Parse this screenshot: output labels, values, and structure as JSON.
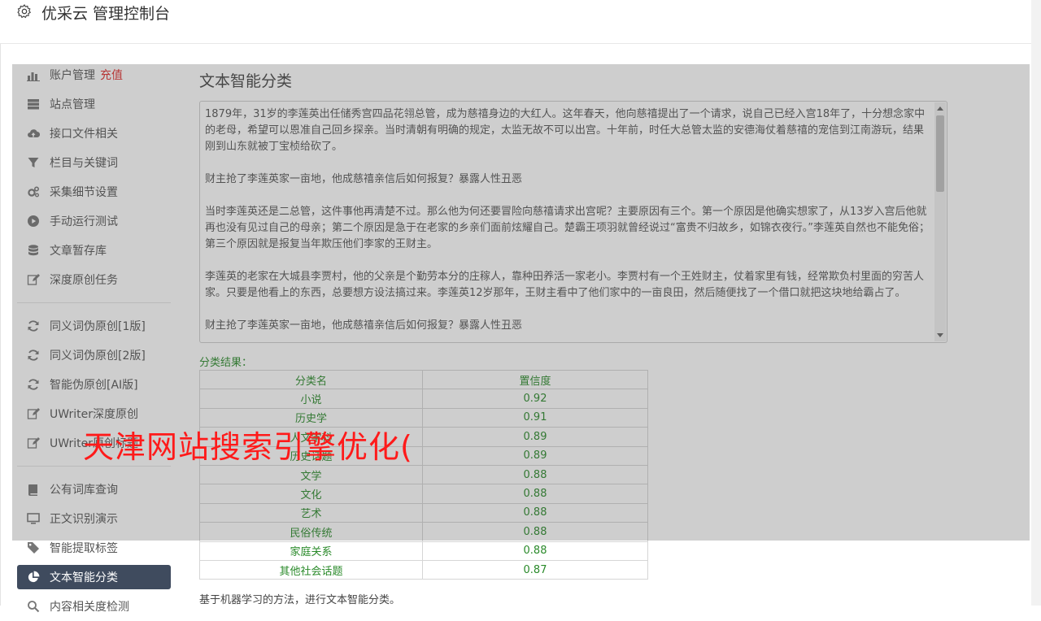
{
  "header": {
    "title": "优采云 管理控制台"
  },
  "sidebar": {
    "groups": [
      [
        {
          "label": "账户管理",
          "badge": "充值",
          "icon": "bar-chart-icon"
        },
        {
          "label": "站点管理",
          "icon": "server-icon"
        },
        {
          "label": "接口文件相关",
          "icon": "cloud-upload-icon"
        },
        {
          "label": "栏目与关键词",
          "icon": "filter-icon"
        },
        {
          "label": "采集细节设置",
          "icon": "gears-icon"
        },
        {
          "label": "手动运行测试",
          "icon": "play-circle-icon"
        },
        {
          "label": "文章暂存库",
          "icon": "database-icon"
        },
        {
          "label": "深度原创任务",
          "icon": "edit-icon"
        }
      ],
      [
        {
          "label": "同义词伪原创[1版]",
          "icon": "refresh-icon"
        },
        {
          "label": "同义词伪原创[2版]",
          "icon": "refresh-icon"
        },
        {
          "label": "智能伪原创[AI版]",
          "icon": "refresh-icon"
        },
        {
          "label": "UWriter深度原创",
          "icon": "edit-icon"
        },
        {
          "label": "UWriter原创标题",
          "icon": "edit-icon"
        }
      ],
      [
        {
          "label": "公有词库查询",
          "icon": "book-icon"
        },
        {
          "label": "正文识别演示",
          "icon": "monitor-icon"
        },
        {
          "label": "智能提取标签",
          "icon": "tag-icon"
        },
        {
          "label": "文本智能分类",
          "icon": "pie-chart-icon",
          "active": true
        },
        {
          "label": "内容相关度检测",
          "icon": "search-icon"
        }
      ]
    ]
  },
  "main": {
    "title": "文本智能分类",
    "text_paragraphs": [
      "1879年，31岁的李莲英出任储秀宫四品花翎总管，成为慈禧身边的大红人。这年春天，他向慈禧提出了一个请求，说自己已经入宫18年了，十分想念家中的老母，希望可以恩准自己回乡探亲。当时清朝有明确的规定，太监无故不可以出宫。十年前，时任大总管太监的安德海仗着慈禧的宠信到江南游玩，结果刚到山东就被丁宝桢给砍了。",
      "财主抢了李莲英家一亩地，他成慈禧亲信后如何报复？暴露人性丑恶",
      "当时李莲英还是二总管，这件事他再清楚不过。那么他为何还要冒险向慈禧请求出宫呢？主要原因有三个。第一个原因是他确实想家了，从13岁入宫后他就再也没有见过自己的母亲；第二个原因是急于在老家的乡亲们面前炫耀自己。楚霸王项羽就曾经说过“富贵不归故乡，如锦衣夜行。”李莲英自然也不能免俗；第三个原因就是报复当年欺压他们李家的王财主。",
      "李莲英的老家在大城县李贾村，他的父亲是个勤劳本分的庄稼人，靠种田养活一家老小。李贾村有一个王姓财主，仗着家里有钱，经常欺负村里面的穷苦人家。只要是他看上的东西，总要想方设法搞过来。李莲英12岁那年，王财主看中了他们家中的一亩良田，然后随便找了一个借口就把这块地给霸占了。",
      "财主抢了李莲英家一亩地，他成慈禧亲信后如何报复？暴露人性丑恶"
    ],
    "result_label": "分类结果：",
    "table": {
      "headers": [
        "分类名",
        "置信度"
      ],
      "rows": [
        [
          "小说",
          "0.92"
        ],
        [
          "历史学",
          "0.91"
        ],
        [
          "人文学科",
          "0.89"
        ],
        [
          "历史话题",
          "0.89"
        ],
        [
          "文学",
          "0.88"
        ],
        [
          "文化",
          "0.88"
        ],
        [
          "艺术",
          "0.88"
        ],
        [
          "民俗传统",
          "0.88"
        ],
        [
          "家庭关系",
          "0.88"
        ],
        [
          "其他社会话题",
          "0.87"
        ]
      ]
    },
    "description": "基于机器学习的方法，进行文本智能分类。"
  },
  "watermark": {
    "text": "天津网站搜索引擎优化("
  },
  "colors": {
    "accent_active": "#3f4b5e",
    "badge_red": "#e02d2d",
    "result_green": "#2a8a2a",
    "watermark_red": "#ff1a1a"
  }
}
